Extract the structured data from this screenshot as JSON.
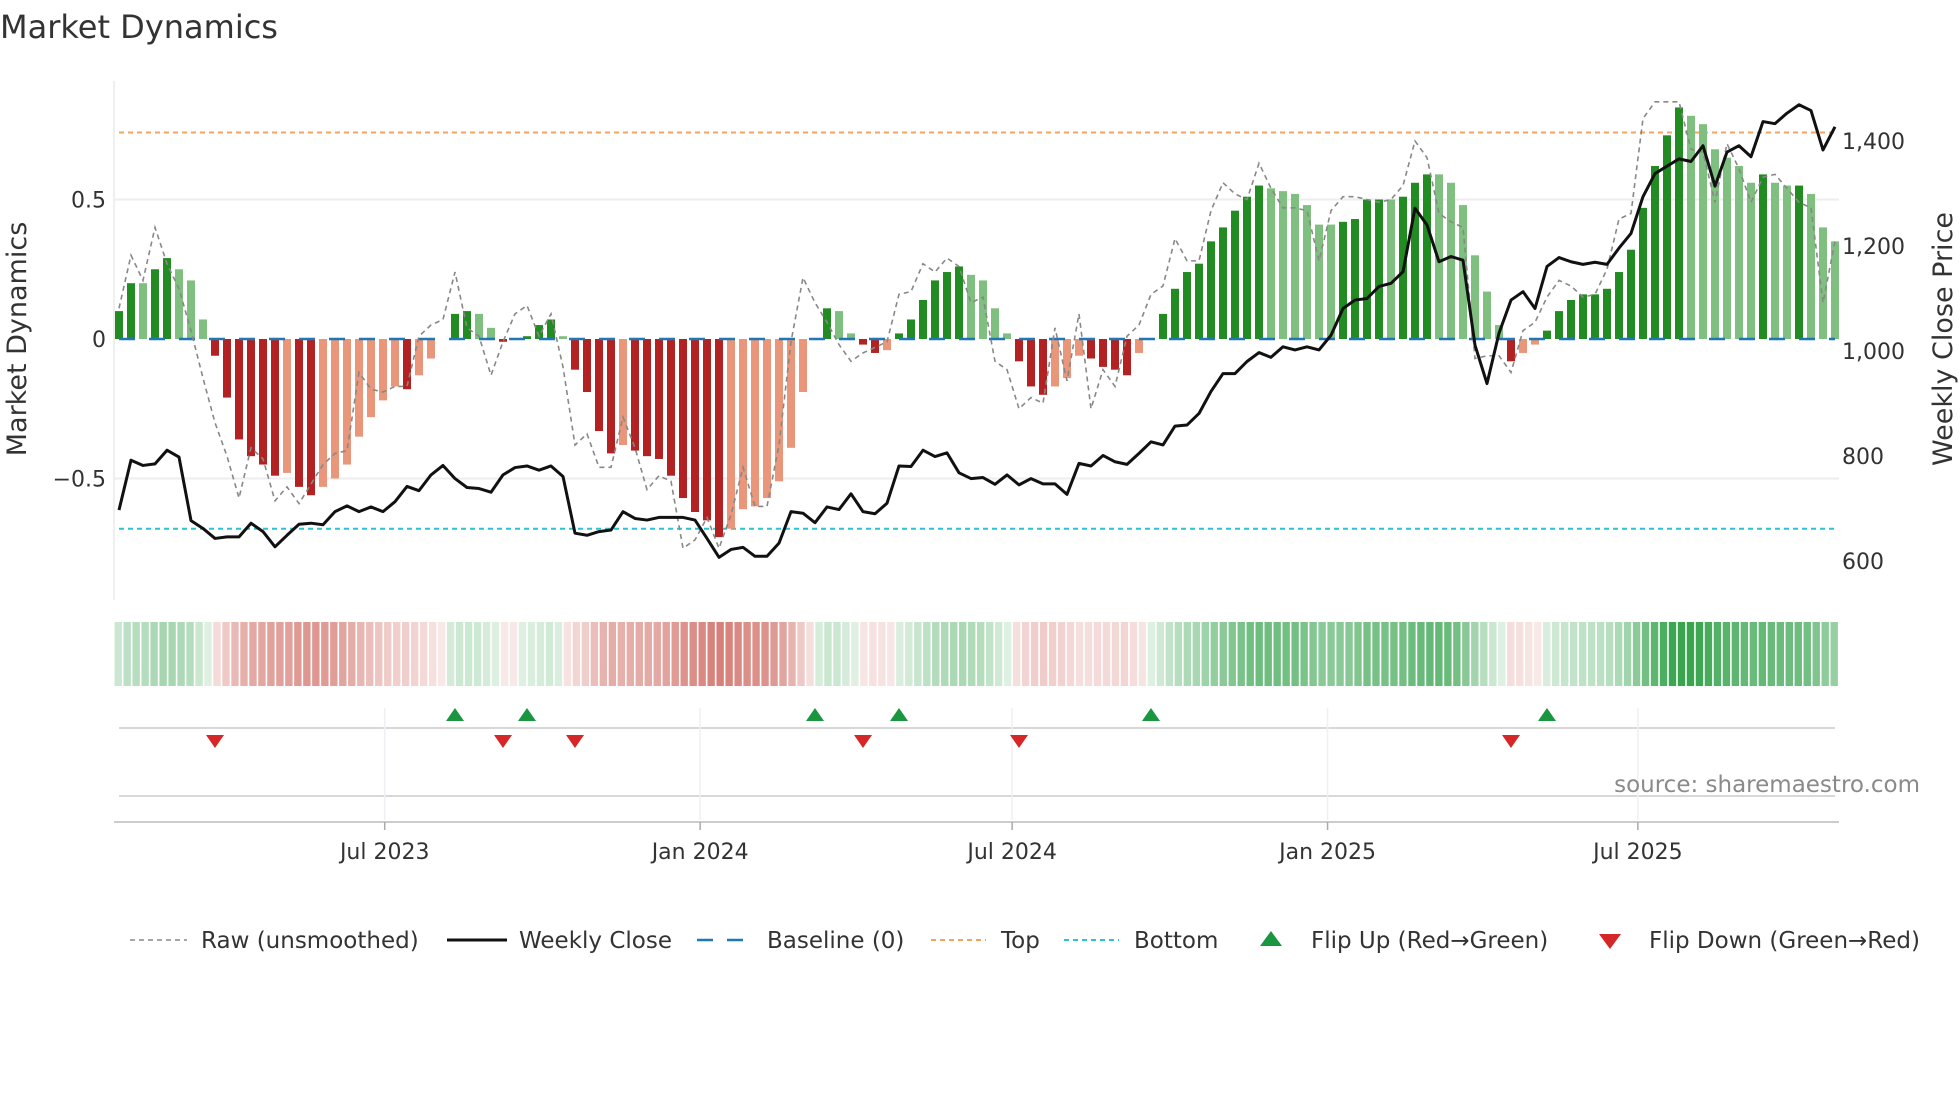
{
  "chart_data": {
    "type": "bar",
    "title": "Market Dynamics",
    "ylabel": "Market Dynamics",
    "y2label": "Weekly Close Price",
    "source": "source: sharemaestro.com",
    "start_date": "2023-01-27",
    "frequency": "weekly",
    "ylim": [
      -0.95,
      0.95
    ],
    "y2lim": [
      515,
      1540
    ],
    "yticks": [
      {
        "v": 0.5,
        "label": "0.5"
      },
      {
        "v": 0,
        "label": "0"
      },
      {
        "v": -0.5,
        "label": "−0.5"
      }
    ],
    "y2ticks": [
      {
        "v": 1400,
        "label": "1,400"
      },
      {
        "v": 1200,
        "label": "1,200"
      },
      {
        "v": 1000,
        "label": "1,000"
      },
      {
        "v": 800,
        "label": "800"
      },
      {
        "v": 600,
        "label": "600"
      }
    ],
    "xticks": [
      {
        "date": "2023-07-01",
        "label": "Jul 2023"
      },
      {
        "date": "2024-01-01",
        "label": "Jan 2024"
      },
      {
        "date": "2024-07-01",
        "label": "Jul 2024"
      },
      {
        "date": "2025-01-01",
        "label": "Jan 2025"
      },
      {
        "date": "2025-07-01",
        "label": "Jul 2025"
      }
    ],
    "top_level": 0.74,
    "bottom_level": -0.68,
    "baseline": 0,
    "smoothed": [
      0.1,
      0.2,
      0.2,
      0.25,
      0.29,
      0.25,
      0.21,
      0.07,
      -0.06,
      -0.21,
      -0.36,
      -0.42,
      -0.45,
      -0.49,
      -0.48,
      -0.53,
      -0.56,
      -0.53,
      -0.5,
      -0.45,
      -0.35,
      -0.28,
      -0.22,
      -0.17,
      -0.18,
      -0.13,
      -0.07,
      0,
      0.09,
      0.1,
      0.09,
      0.04,
      -0.01,
      0,
      0.01,
      0.05,
      0.07,
      0.01,
      -0.11,
      -0.19,
      -0.33,
      -0.41,
      -0.38,
      -0.4,
      -0.42,
      -0.43,
      -0.49,
      -0.57,
      -0.62,
      -0.65,
      -0.71,
      -0.68,
      -0.61,
      -0.6,
      -0.57,
      -0.51,
      -0.39,
      -0.19,
      0,
      0.11,
      0.1,
      0.02,
      -0.02,
      -0.05,
      -0.04,
      0.02,
      0.07,
      0.14,
      0.21,
      0.24,
      0.26,
      0.23,
      0.21,
      0.11,
      0.02,
      -0.08,
      -0.17,
      -0.2,
      -0.17,
      -0.14,
      -0.06,
      -0.07,
      -0.1,
      -0.11,
      -0.13,
      -0.05,
      0,
      0.09,
      0.18,
      0.24,
      0.27,
      0.35,
      0.4,
      0.46,
      0.51,
      0.55,
      0.54,
      0.53,
      0.52,
      0.48,
      0.41,
      0.41,
      0.42,
      0.43,
      0.5,
      0.5,
      0.5,
      0.51,
      0.56,
      0.59,
      0.59,
      0.56,
      0.48,
      0.3,
      0.17,
      0.05,
      -0.08,
      -0.05,
      -0.02,
      0.03,
      0.1,
      0.14,
      0.16,
      0.16,
      0.18,
      0.24,
      0.32,
      0.47,
      0.62,
      0.73,
      0.83,
      0.8,
      0.77,
      0.68,
      0.65,
      0.62,
      0.56,
      0.59,
      0.56,
      0.55,
      0.55,
      0.52,
      0.4,
      0.35
    ],
    "strengthening": [
      1,
      1,
      0,
      1,
      1,
      0,
      0,
      0,
      1,
      1,
      1,
      1,
      1,
      1,
      0,
      1,
      1,
      0,
      0,
      0,
      0,
      0,
      0,
      0,
      1,
      0,
      0,
      0,
      1,
      1,
      0,
      0,
      1,
      0,
      1,
      1,
      1,
      0,
      1,
      1,
      1,
      1,
      0,
      1,
      1,
      1,
      1,
      1,
      1,
      1,
      1,
      0,
      0,
      0,
      0,
      0,
      0,
      0,
      0,
      1,
      0,
      0,
      1,
      1,
      0,
      1,
      1,
      1,
      1,
      1,
      1,
      0,
      0,
      0,
      0,
      1,
      1,
      1,
      0,
      0,
      0,
      1,
      1,
      1,
      1,
      0,
      0,
      1,
      1,
      1,
      1,
      1,
      1,
      1,
      1,
      1,
      0,
      0,
      0,
      0,
      0,
      0,
      1,
      1,
      1,
      1,
      0,
      1,
      1,
      1,
      0,
      0,
      0,
      0,
      0,
      0,
      1,
      0,
      0,
      1,
      1,
      1,
      1,
      1,
      1,
      1,
      1,
      1,
      1,
      1,
      1,
      0,
      0,
      0,
      0,
      0,
      0,
      1,
      0,
      0,
      1,
      0,
      0,
      0
    ],
    "raw": [
      0.11,
      0.3,
      0.21,
      0.4,
      0.27,
      0.18,
      0.03,
      -0.14,
      -0.3,
      -0.42,
      -0.57,
      -0.39,
      -0.43,
      -0.58,
      -0.53,
      -0.59,
      -0.52,
      -0.45,
      -0.41,
      -0.4,
      -0.12,
      -0.18,
      -0.19,
      -0.17,
      -0.17,
      0.01,
      0.05,
      0.07,
      0.24,
      0.04,
      0.01,
      -0.13,
      -0.01,
      0.09,
      0.12,
      0.01,
      0.09,
      -0.1,
      -0.38,
      -0.34,
      -0.46,
      -0.46,
      -0.28,
      -0.39,
      -0.54,
      -0.49,
      -0.51,
      -0.75,
      -0.72,
      -0.64,
      -0.75,
      -0.63,
      -0.46,
      -0.6,
      -0.6,
      -0.38,
      -0.01,
      0.22,
      0.13,
      0.06,
      -0.02,
      -0.08,
      -0.05,
      -0.03,
      -0.01,
      0.16,
      0.17,
      0.27,
      0.24,
      0.29,
      0.26,
      0.13,
      0.15,
      -0.08,
      -0.11,
      -0.25,
      -0.21,
      -0.23,
      0.04,
      -0.15,
      0.09,
      -0.25,
      -0.11,
      -0.17,
      0.01,
      0.05,
      0.16,
      0.19,
      0.36,
      0.28,
      0.28,
      0.46,
      0.56,
      0.52,
      0.5,
      0.63,
      0.54,
      0.47,
      0.47,
      0.46,
      0.28,
      0.46,
      0.51,
      0.51,
      0.5,
      0.49,
      0.5,
      0.55,
      0.71,
      0.65,
      0.45,
      0.42,
      0.4,
      -0.07,
      -0.06,
      -0.06,
      -0.12,
      0.03,
      0.06,
      0.15,
      0.21,
      0.19,
      0.15,
      0.16,
      0.25,
      0.43,
      0.45,
      0.79,
      0.85,
      0.85,
      0.85,
      0.68,
      0.67,
      0.49,
      0.7,
      0.61,
      0.49,
      0.58,
      0.59,
      0.54,
      0.49,
      0.47,
      0.13,
      0.35
    ],
    "weekly_close": [
      697,
      792,
      782,
      785,
      811,
      798,
      677,
      662,
      643,
      646,
      646,
      672,
      656,
      627,
      649,
      670,
      672,
      669,
      694,
      705,
      694,
      703,
      694,
      713,
      742,
      734,
      764,
      782,
      757,
      740,
      738,
      731,
      764,
      778,
      781,
      773,
      781,
      761,
      653,
      649,
      656,
      659,
      694,
      681,
      678,
      683,
      683,
      683,
      678,
      643,
      607,
      622,
      626,
      609,
      609,
      634,
      694,
      691,
      673,
      703,
      698,
      728,
      694,
      690,
      710,
      781,
      780,
      811,
      799,
      806,
      768,
      757,
      759,
      746,
      764,
      745,
      757,
      747,
      747,
      727,
      786,
      781,
      801,
      789,
      784,
      805,
      827,
      821,
      857,
      859,
      881,
      923,
      957,
      957,
      980,
      997,
      988,
      1008,
      1002,
      1008,
      1002,
      1030,
      1081,
      1097,
      1100,
      1123,
      1129,
      1151,
      1272,
      1240,
      1170,
      1180,
      1173,
      1011,
      938,
      1034,
      1097,
      1113,
      1081,
      1161,
      1178,
      1170,
      1165,
      1169,
      1165,
      1196,
      1224,
      1294,
      1338,
      1352,
      1366,
      1361,
      1391,
      1314,
      1379,
      1391,
      1370,
      1437,
      1433,
      1453,
      1469,
      1458,
      1383,
      1427
    ],
    "flip_up_dates": [
      "2023-08-11",
      "2023-09-22",
      "2024-03-08",
      "2024-04-26",
      "2024-09-20",
      "2025-05-09"
    ],
    "flip_down_dates": [
      "2023-03-24",
      "2023-09-08",
      "2023-10-20",
      "2024-04-05",
      "2024-07-05",
      "2025-04-18"
    ],
    "legend": {
      "placement": "bottom",
      "entries": [
        "Raw (unsmoothed)",
        "Weekly Close",
        "Baseline (0)",
        "Top",
        "Bottom",
        "Flip Up (Red→Green)",
        "Flip Down (Green→Red)"
      ]
    },
    "colors": {
      "up_strong": "#228b22",
      "up_weak": "#7fbf7f",
      "down_strong": "#b22222",
      "down_weak": "#e9967a",
      "raw": "#888888",
      "close": "#111111",
      "baseline": "#1f77b4",
      "top": "#f4a460",
      "bottom": "#2bc4d4",
      "flip_up": "#1a9641",
      "flip_down": "#d62728"
    }
  }
}
